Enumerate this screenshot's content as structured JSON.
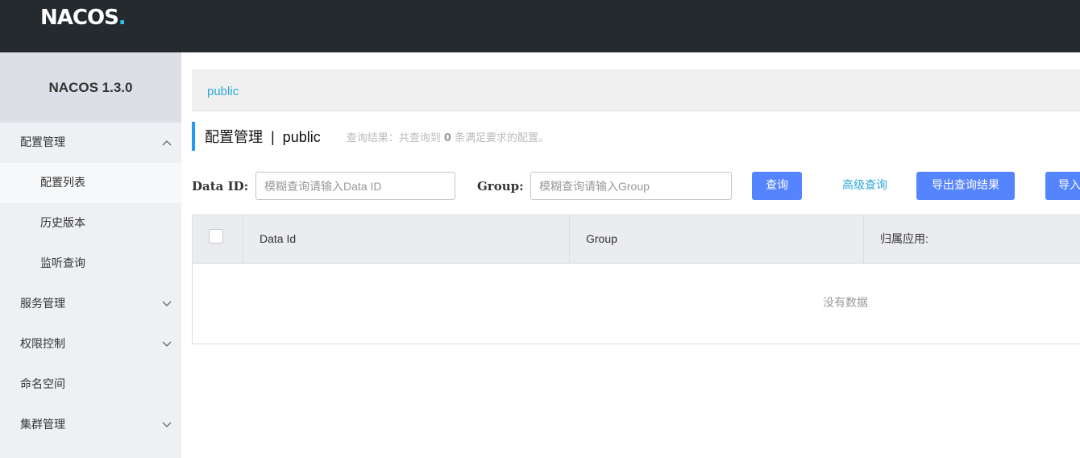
{
  "brand": {
    "logo_text": "NACOS",
    "logo_dot": "."
  },
  "sidebar": {
    "version": "NACOS 1.3.0",
    "items": [
      {
        "label": "配置管理",
        "chevron": "up"
      },
      {
        "label": "配置列表",
        "sub": true,
        "active": true
      },
      {
        "label": "历史版本",
        "sub": true
      },
      {
        "label": "监听查询",
        "sub": true
      },
      {
        "label": "服务管理",
        "chevron": "down"
      },
      {
        "label": "权限控制",
        "chevron": "down"
      },
      {
        "label": "命名空间"
      },
      {
        "label": "集群管理",
        "chevron": "down"
      }
    ]
  },
  "breadcrumb": {
    "namespace": "public"
  },
  "header": {
    "title": "配置管理  |  public",
    "result_prefix": "查询结果：共查询到 ",
    "result_count": "0",
    "result_suffix": " 条满足要求的配置。"
  },
  "filters": {
    "data_id_label": "Data ID:",
    "data_id_placeholder": "模糊查询请输入Data ID",
    "data_id_value": "",
    "group_label": "Group:",
    "group_placeholder": "模糊查询请输入Group",
    "group_value": "",
    "search_button": "查询",
    "advanced_link": "高级查询",
    "export_button": "导出查询结果",
    "import_button": "导入"
  },
  "table": {
    "columns": [
      "Data Id",
      "Group",
      "归属应用:"
    ],
    "empty_text": "没有数据"
  },
  "colors": {
    "topbar": "#252a2f",
    "accent": "#5584ff",
    "link": "#2ea8d8",
    "title_bar": "#209bfa"
  }
}
